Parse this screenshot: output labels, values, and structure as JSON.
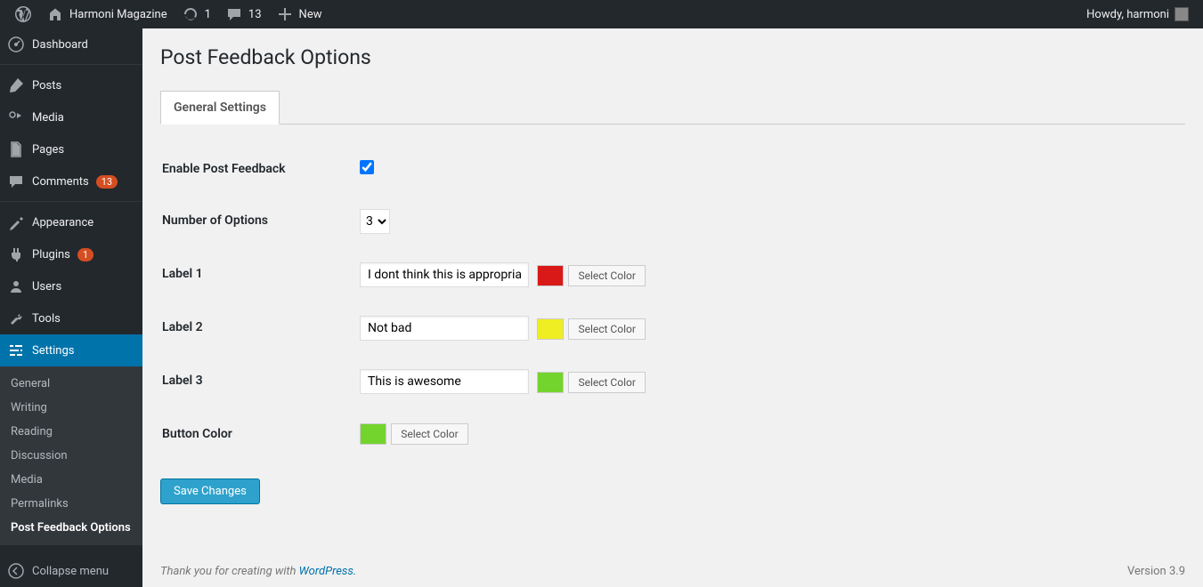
{
  "adminbar": {
    "site_name": "Harmoni Magazine",
    "updates_count": "1",
    "comments_count": "13",
    "new_label": "New",
    "howdy": "Howdy, harmoni"
  },
  "sidebar": {
    "items": [
      {
        "label": "Dashboard",
        "icon": "dashboard"
      },
      {
        "label": "Posts",
        "icon": "pin"
      },
      {
        "label": "Media",
        "icon": "media"
      },
      {
        "label": "Pages",
        "icon": "page"
      },
      {
        "label": "Comments",
        "icon": "comment",
        "badge": "13"
      },
      {
        "label": "Appearance",
        "icon": "brush"
      },
      {
        "label": "Plugins",
        "icon": "plug",
        "badge": "1"
      },
      {
        "label": "Users",
        "icon": "user"
      },
      {
        "label": "Tools",
        "icon": "wrench"
      },
      {
        "label": "Settings",
        "icon": "settings"
      }
    ],
    "submenu": [
      {
        "label": "General"
      },
      {
        "label": "Writing"
      },
      {
        "label": "Reading"
      },
      {
        "label": "Discussion"
      },
      {
        "label": "Media"
      },
      {
        "label": "Permalinks"
      },
      {
        "label": "Post Feedback Options",
        "current": true
      }
    ],
    "collapse": "Collapse menu"
  },
  "page": {
    "title": "Post Feedback Options",
    "tab": "General Settings",
    "rows": {
      "enable_label": "Enable Post Feedback",
      "number_label": "Number of Options",
      "number_value": "3",
      "label1": "Label 1",
      "label1_value": "I dont think this is appropriate",
      "label1_color": "#d91818",
      "label2": "Label 2",
      "label2_value": "Not bad",
      "label2_color": "#eeee22",
      "label3": "Label 3",
      "label3_value": "This is awesome",
      "label3_color": "#74d42e",
      "button_color_label": "Button Color",
      "button_color": "#74d42e",
      "select_color": "Select Color"
    },
    "save": "Save Changes"
  },
  "footer": {
    "thanks_pre": "Thank you for creating with ",
    "thanks_link": "WordPress.",
    "version": "Version 3.9"
  }
}
